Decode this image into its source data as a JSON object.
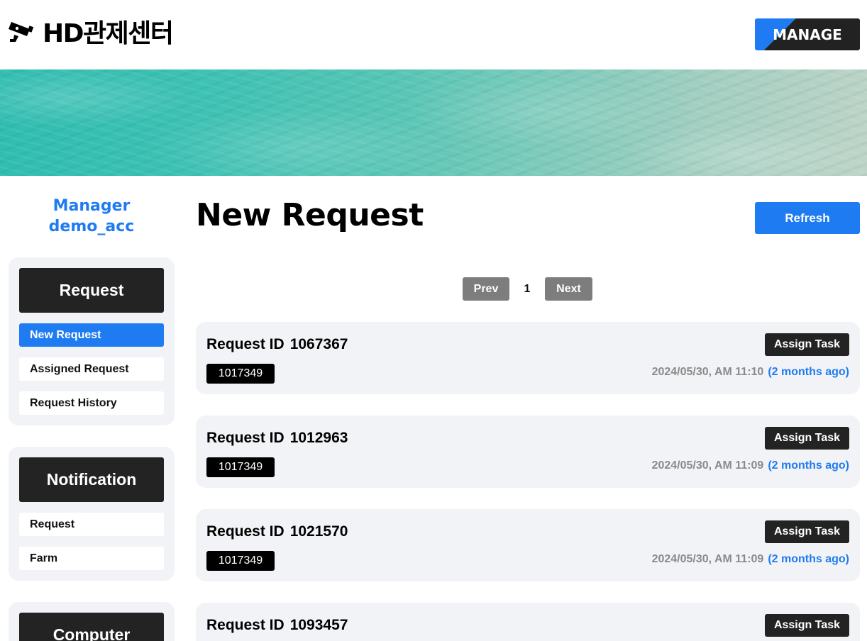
{
  "header": {
    "logo_text": "HD관제센터",
    "logo_icon": "cctv-camera-icon",
    "manage_label": "MANAGE"
  },
  "user": {
    "role": "Manager",
    "account": "demo_acc"
  },
  "sidebar": {
    "groups": [
      {
        "title": "Request",
        "items": [
          {
            "label": "New Request",
            "active": true
          },
          {
            "label": "Assigned Request",
            "active": false
          },
          {
            "label": "Request History",
            "active": false
          }
        ]
      },
      {
        "title": "Notification",
        "items": [
          {
            "label": "Request",
            "active": false
          },
          {
            "label": "Farm",
            "active": false
          }
        ]
      },
      {
        "title": "Computer",
        "items": []
      }
    ]
  },
  "main": {
    "title": "New Request",
    "refresh_label": "Refresh",
    "pager": {
      "prev_label": "Prev",
      "current_page": "1",
      "next_label": "Next"
    },
    "requests": [
      {
        "id_label": "Request ID",
        "id": "1067367",
        "tag": "1017349",
        "date": "2024/05/30, AM 11:10",
        "ago": "(2 months ago)",
        "assign_label": "Assign Task"
      },
      {
        "id_label": "Request ID",
        "id": "1012963",
        "tag": "1017349",
        "date": "2024/05/30, AM 11:09",
        "ago": "(2 months ago)",
        "assign_label": "Assign Task"
      },
      {
        "id_label": "Request ID",
        "id": "1021570",
        "tag": "1017349",
        "date": "2024/05/30, AM 11:09",
        "ago": "(2 months ago)",
        "assign_label": "Assign Task"
      },
      {
        "id_label": "Request ID",
        "id": "1093457",
        "tag": "",
        "date": "",
        "ago": "",
        "assign_label": "Assign Task"
      }
    ]
  },
  "colors": {
    "accent": "#1f7bf2",
    "dark": "#232323",
    "card_bg": "#f2f3f6",
    "pager_bg": "#7d7d7d"
  }
}
